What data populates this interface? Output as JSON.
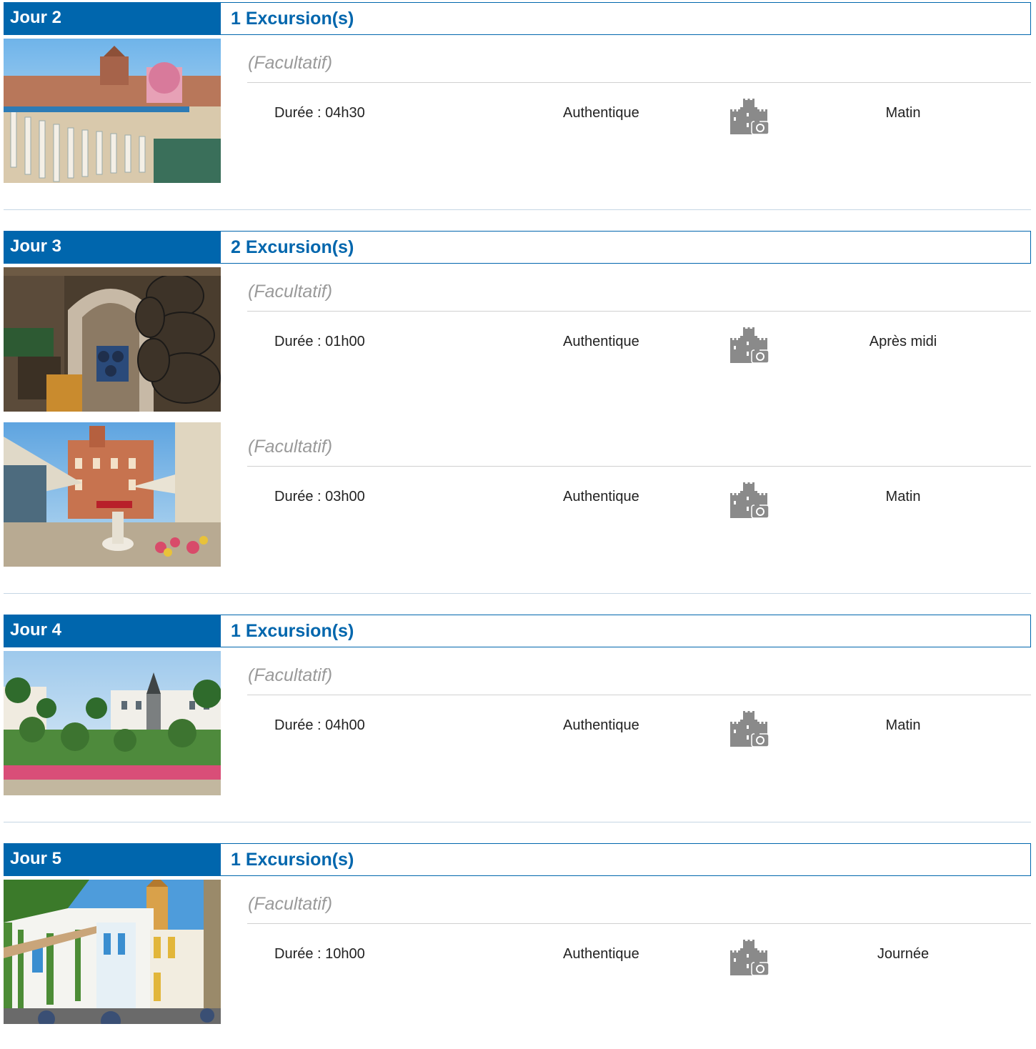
{
  "days": [
    {
      "label": "Jour 2",
      "count": "1 Excursion(s)",
      "excursions": [
        {
          "facultatif": "(Facultatif)",
          "duree": "Durée : 04h30",
          "type": "Authentique",
          "icon": "castle-camera-icon",
          "moment": "Matin",
          "photo": "plaza-balustrade"
        }
      ]
    },
    {
      "label": "Jour 3",
      "count": "2 Excursion(s)",
      "excursions": [
        {
          "facultatif": "(Facultatif)",
          "duree": "Durée : 01h00",
          "type": "Authentique",
          "icon": "castle-camera-icon",
          "moment": "Après midi",
          "photo": "wine-cellar"
        },
        {
          "facultatif": "(Facultatif)",
          "duree": "Durée : 03h00",
          "type": "Authentique",
          "icon": "castle-camera-icon",
          "moment": "Matin",
          "photo": "flower-market"
        }
      ]
    },
    {
      "label": "Jour 4",
      "count": "1 Excursion(s)",
      "excursions": [
        {
          "facultatif": "(Facultatif)",
          "duree": "Durée : 04h00",
          "type": "Authentique",
          "icon": "castle-camera-icon",
          "moment": "Matin",
          "photo": "statue-square"
        }
      ]
    },
    {
      "label": "Jour 5",
      "count": "1 Excursion(s)",
      "excursions": [
        {
          "facultatif": "(Facultatif)",
          "duree": "Durée : 10h00",
          "type": "Authentique",
          "icon": "castle-camera-icon",
          "moment": "Journée",
          "photo": "white-street"
        }
      ]
    }
  ],
  "colors": {
    "accent": "#0066ad",
    "muted": "#9a9a9a",
    "icon": "#8a8a8a"
  }
}
